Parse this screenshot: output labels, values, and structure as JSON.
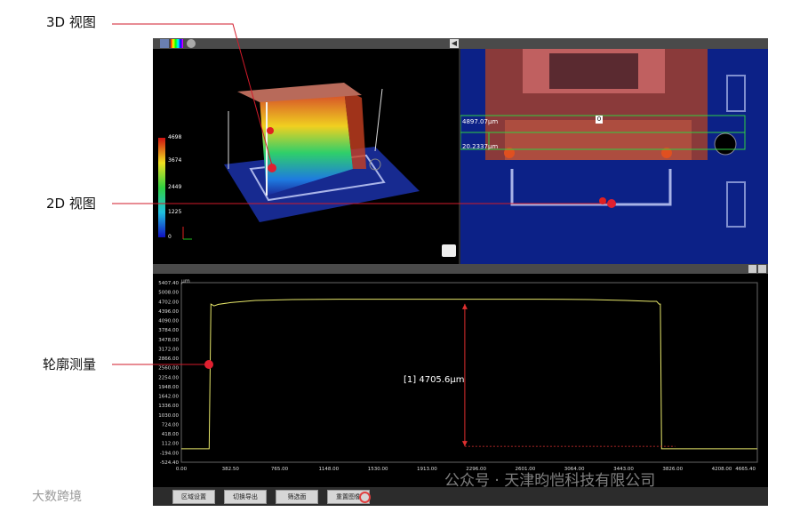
{
  "callouts": {
    "view3d": "3D 视图",
    "view2d": "2D 视图",
    "profile": "轮廓测量"
  },
  "view3d": {
    "colorbar_ticks": [
      "4698",
      "3674",
      "2449",
      "1225",
      "0"
    ]
  },
  "view2d": {
    "measure_top": "4897.07μm",
    "measure_bottom": "20.2337μm",
    "marker_label": "0"
  },
  "chart_data": {
    "type": "line",
    "title": "",
    "xlabel": "",
    "ylabel": "",
    "unit_label": "μm",
    "y_ticks": [
      "5407.40",
      "5008.00",
      "4702.00",
      "4396.00",
      "4090.00",
      "3784.00",
      "3478.00",
      "3172.00",
      "2866.00",
      "2560.00",
      "2254.00",
      "1948.00",
      "1642.00",
      "1336.00",
      "1030.00",
      "724.00",
      "418.00",
      "112.00",
      "-194.00",
      "-524.40"
    ],
    "x_ticks": [
      "0.00",
      "382.50",
      "765.00",
      "1148.00",
      "1530.00",
      "1913.00",
      "2296.00",
      "2601.00",
      "3064.00",
      "3443.00",
      "3826.00",
      "4208.00"
    ],
    "x_tail_tick": "4665.40",
    "ylim": [
      -524.4,
      5407.4
    ],
    "xlim": [
      0,
      4665.4
    ],
    "series": [
      {
        "color": "#e8e86a",
        "x": [
          0,
          200,
          225,
          240,
          265,
          300,
          400,
          600,
          900,
          1300,
          1700,
          2100,
          2500,
          2900,
          3300,
          3600,
          3800,
          3850,
          3870,
          3880,
          3890,
          3900,
          4200,
          4665
        ],
        "y": [
          -80,
          -80,
          -80,
          4700,
          4640,
          4690,
          4750,
          4820,
          4850,
          4860,
          4860,
          4860,
          4860,
          4860,
          4850,
          4820,
          4790,
          4790,
          4700,
          4700,
          -80,
          -80,
          -80,
          -80
        ]
      }
    ],
    "annotation": {
      "label": "[1] 4705.6μm",
      "x": 2296,
      "y_top": 4705.6,
      "y_bottom": 0
    }
  },
  "toolbar": {
    "buttons": [
      "区域设置",
      "切换导出",
      "筛选面",
      "重置图像"
    ]
  },
  "watermarks": {
    "left": "大数跨境",
    "right": "公众号 · 天津昀恺科技有限公司"
  }
}
